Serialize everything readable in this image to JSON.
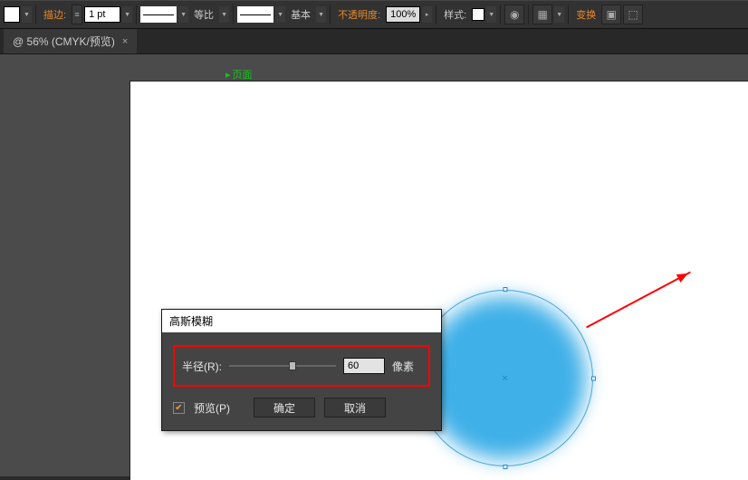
{
  "toolbar": {
    "stroke_label": "描边:",
    "stroke_weight": "1 pt",
    "dash_label": "等比",
    "profile_label": "基本",
    "opacity_label": "不透明度:",
    "opacity_value": "100%",
    "style_label": "样式:",
    "transform_label": "变换"
  },
  "tab": {
    "title": "@ 56% (CMYK/预览)",
    "close": "×"
  },
  "canvas": {
    "page_tag": "页面"
  },
  "dialog": {
    "title": "高斯模糊",
    "radius_label": "半径(R):",
    "radius_value": "60",
    "unit_label": "像素",
    "preview_label": "预览(P)",
    "ok_label": "确定",
    "cancel_label": "取消"
  }
}
